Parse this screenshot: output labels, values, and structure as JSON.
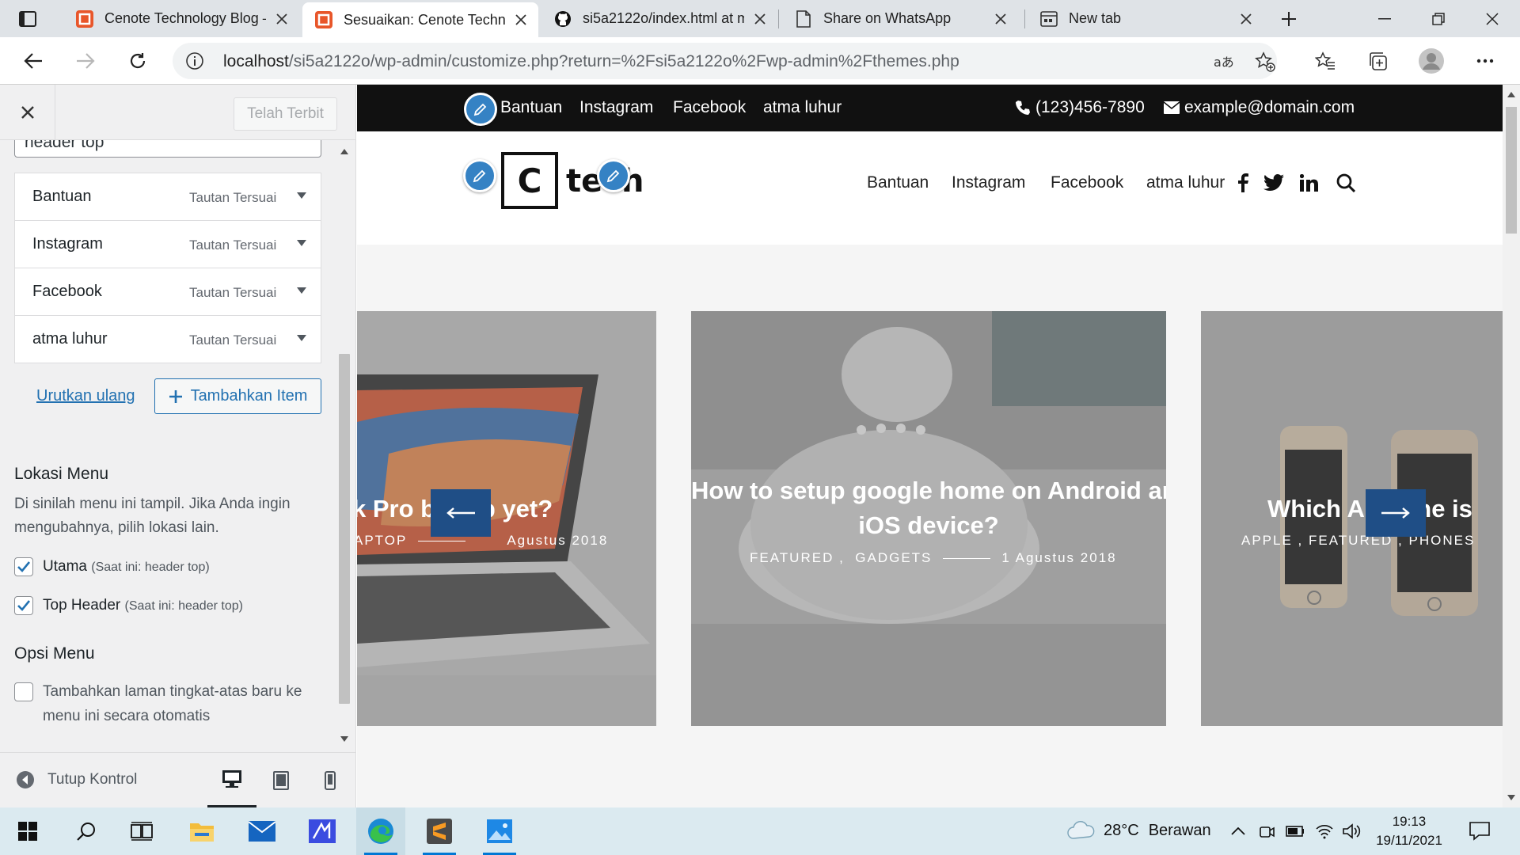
{
  "browser": {
    "tabs": [
      {
        "title": "Cenote Technology Blog – ",
        "icon": "wordpress-logo-icon"
      },
      {
        "title": "Sesuaikan: Cenote Techno",
        "icon": "wordpress-logo-icon"
      },
      {
        "title": "si5a2122o/index.html at m",
        "icon": "github-icon"
      },
      {
        "title": "Share on WhatsApp",
        "icon": "page-icon"
      },
      {
        "title": "New tab",
        "icon": "newtab-icon"
      }
    ],
    "url_host": "localhost",
    "url_path": "/si5a2122o/wp-admin/customize.php?return=%2Fsi5a2122o%2Fwp-admin%2Fthemes.php"
  },
  "customizer": {
    "publish_label": "Telah Terbit",
    "search_value": "header top",
    "menu_items": [
      {
        "title": "Bantuan",
        "type": "Tautan Tersuai"
      },
      {
        "title": "Instagram",
        "type": "Tautan Tersuai"
      },
      {
        "title": "Facebook",
        "type": "Tautan Tersuai"
      },
      {
        "title": "atma luhur",
        "type": "Tautan Tersuai"
      }
    ],
    "reorder_label": "Urutkan ulang",
    "add_item_label": "Tambahkan Item",
    "locations": {
      "title": "Lokasi Menu",
      "description": "Di sinilah menu ini tampil. Jika Anda ingin mengubahnya, pilih lokasi lain.",
      "options": [
        {
          "label": "Utama",
          "sub": "(Saat ini: header top)",
          "checked": true
        },
        {
          "label": "Top Header",
          "sub": "(Saat ini: header top)",
          "checked": true
        }
      ]
    },
    "options": {
      "title": "Opsi Menu",
      "auto_add_label": "Tambahkan laman tingkat-atas baru ke menu ini secara otomatis",
      "auto_add_checked": false
    },
    "collapse_label": "Tutup Kontrol"
  },
  "site": {
    "top_links": [
      "Bantuan",
      "Instagram",
      "Facebook",
      "atma luhur"
    ],
    "phone": "(123)456-7890",
    "email": "example@domain.com",
    "logo_letter": "C",
    "logo_text": "tech",
    "nav_links": [
      "Bantuan",
      "Instagram",
      "Facebook",
      "atma luhur"
    ],
    "social_icons": [
      "facebook-icon",
      "twitter-icon",
      "linkedin-icon",
      "search-icon"
    ],
    "slides": [
      {
        "title": "k Pro b      btop yet?",
        "meta_left": "APTOP",
        "meta_date": "Agustus 2018"
      },
      {
        "title_line1": "How to setup google home on Android and",
        "title_line2": "iOS device?",
        "cat1": "FEATURED",
        "cat2": "GADGETS",
        "date": "1 Agustus 2018"
      },
      {
        "title": "Which Ap      hone is",
        "meta": "APPLE ,  FEATURED ,  PHONES"
      }
    ]
  },
  "taskbar": {
    "temperature": "28°C",
    "weather": "Berawan",
    "time": "19:13",
    "date": "19/11/2021"
  },
  "colors": {
    "wp_blue": "#2271b1",
    "slider_arrow": "#1f4e86",
    "topbar": "#111111"
  }
}
